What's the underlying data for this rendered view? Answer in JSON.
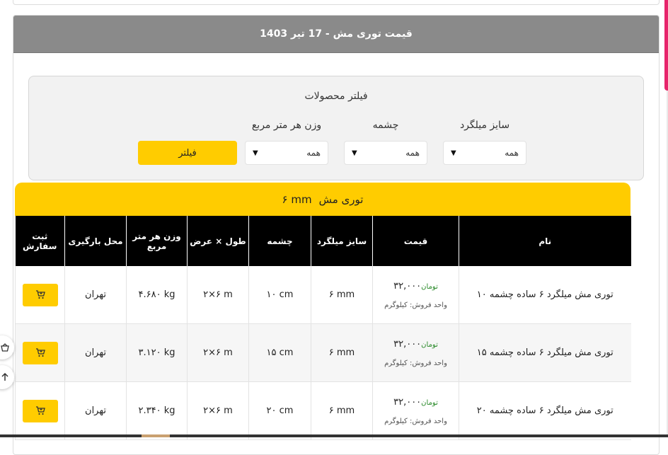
{
  "page": {
    "title": "قیمت توری مش - 17 تیر 1403"
  },
  "filter": {
    "title": "فیلتر محصولات",
    "size_label": "سایز میلگرد",
    "mesh_label": "چشمه",
    "weight_label": "وزن هر متر مربع",
    "size_value": "همه",
    "mesh_value": "همه",
    "weight_value": "همه",
    "button_label": "فیلتر"
  },
  "section": {
    "title": "توری مش",
    "size": "۶ mm"
  },
  "table": {
    "headers": [
      "نام",
      "قیمت",
      "سایز میلگرد",
      "چشمه",
      "طول × عرض",
      "وزن هر متر مربع",
      "محل بارگیری",
      "ثبت سفارش"
    ],
    "rows": [
      {
        "name": "توری مش میلگرد ۶ ساده چشمه ۱۰",
        "price": "۳۲,۰۰۰",
        "currency": "تومان",
        "unit": "واحد فروش: کیلوگرم",
        "rebar_size": "۶ mm",
        "mesh": "۱۰ cm",
        "dimensions": "۲×۶ m",
        "weight": "۴.۶۸۰ kg",
        "location": "تهران"
      },
      {
        "name": "توری مش میلگرد ۶ ساده چشمه ۱۵",
        "price": "۳۲,۰۰۰",
        "currency": "تومان",
        "unit": "واحد فروش: کیلوگرم",
        "rebar_size": "۶ mm",
        "mesh": "۱۵ cm",
        "dimensions": "۲×۶ m",
        "weight": "۳.۱۲۰ kg",
        "location": "تهران"
      },
      {
        "name": "توری مش میلگرد ۶ ساده چشمه ۲۰",
        "price": "۳۲,۰۰۰",
        "currency": "تومان",
        "unit": "واحد فروش: کیلوگرم",
        "rebar_size": "۶ mm",
        "mesh": "۲۰ cm",
        "dimensions": "۲×۶ m",
        "weight": "۲.۳۴۰ kg",
        "location": "تهران"
      }
    ]
  },
  "icons": {
    "cart": "cart-icon",
    "chevron": "chevron-down-icon",
    "side_top": "basket-icon",
    "side_bottom": "arrow-up-icon"
  },
  "colors": {
    "accent": "#ffcc00",
    "header_gray": "#8a8a8a",
    "table_header": "#000000",
    "price_unit": "#2a8a2a"
  }
}
